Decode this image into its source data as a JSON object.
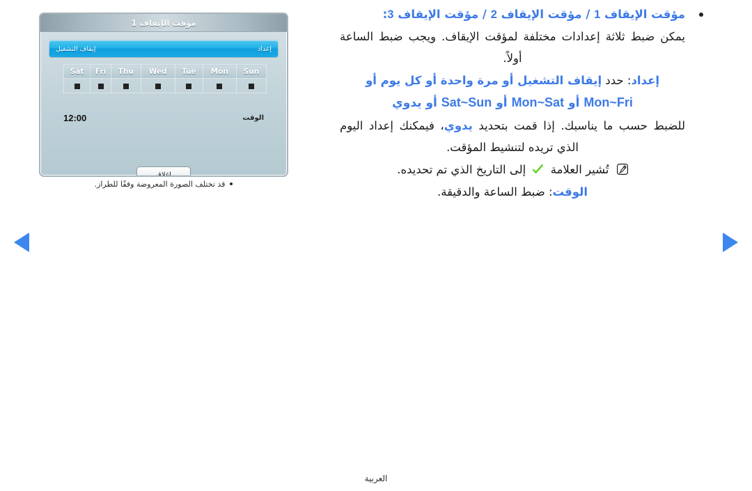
{
  "tv_dialog": {
    "title": "مؤقت الإيقاف 1",
    "setting_row": {
      "label": "إعداد",
      "value": "إيقاف التشغيل"
    },
    "day_headers": [
      "Sun",
      "Mon",
      "Tue",
      "Wed",
      "Thu",
      "Fri",
      "Sat"
    ],
    "time_row": {
      "label": "الوقت",
      "value": "12:00"
    },
    "close_button": "إغلاق",
    "caption": "قد تختلف الصورة المعروضة وفقًا للطراز."
  },
  "manual": {
    "lead_heading": {
      "part1": "مؤقت الإيقاف",
      "n1": "1",
      "sep1": "/",
      "part2": "مؤقت الإيقاف",
      "n2": "2",
      "sep2": "/",
      "part3": "مؤقت الإيقاف",
      "n3": "3",
      "colon": ":"
    },
    "lead_body": "يمكن ضبط ثلاثة إعدادات مختلفة لمؤقت الإيقاف. ويجب ضبط الساعة أولاً.",
    "setup_label": "إعداد",
    "setup_colon": ":",
    "setup_text_a": "حدد",
    "setup_keywords_a": "إيقاف التشغيل أو مرة واحدة أو كل يوم أو",
    "setup_en_1": "Mon~Fri",
    "setup_or_1": "أو",
    "setup_en_2": "Mon~Sat",
    "setup_or_2": "أو",
    "setup_en_3": "Sat~Sun",
    "setup_or_3": "أو",
    "setup_manual_kw": "يدوي",
    "setup_body_1": "للضبط حسب ما يناسبك. إذا قمت بتحديد",
    "setup_manual_kw2": "يدوي",
    "setup_body_2": "، فيمكنك إعداد اليوم الذي تريده لتنشيط المؤقت.",
    "note_text_1": "تُشير العلامة",
    "note_text_2": "إلى التاريخ الذي تم تحديده.",
    "time_label": "الوقت",
    "time_colon": ":",
    "time_text": "ضبط الساعة والدقيقة."
  },
  "footer": {
    "language": "العربية"
  },
  "icons": {
    "note": "note-icon",
    "check": "check-icon",
    "prev_arrow": "triangle-left-icon",
    "next_arrow": "triangle-right-icon"
  },
  "colors": {
    "accent_blue": "#3d7ae8",
    "nav_arrow_blue": "#3d86f0",
    "check_green": "#5fd41c",
    "highlight_cyan": "#1aa9e4"
  }
}
